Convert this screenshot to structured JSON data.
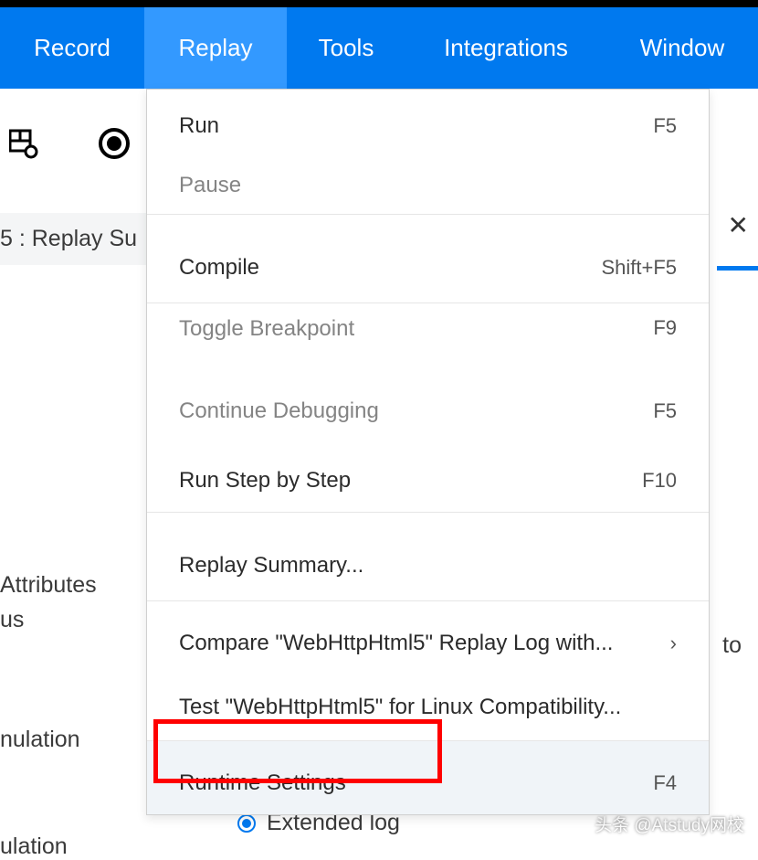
{
  "menubar": {
    "record": "Record",
    "replay": "Replay",
    "tools": "Tools",
    "integrations": "Integrations",
    "window": "Window"
  },
  "replay_menu": {
    "run": {
      "label": "Run",
      "shortcut": "F5"
    },
    "pause": {
      "label": "Pause"
    },
    "compile": {
      "label": "Compile",
      "shortcut": "Shift+F5"
    },
    "toggle_breakpoint": {
      "label": "Toggle Breakpoint",
      "shortcut": "F9"
    },
    "continue_debugging": {
      "label": "Continue Debugging",
      "shortcut": "F5"
    },
    "run_step": {
      "label": "Run Step by Step",
      "shortcut": "F10"
    },
    "replay_summary": {
      "label": "Replay Summary..."
    },
    "compare": {
      "label": "Compare \"WebHttpHtml5\" Replay Log with..."
    },
    "test_linux": {
      "label": "Test \"WebHttpHtml5\" for Linux Compatibility..."
    },
    "runtime_settings": {
      "label": "Runtime Settings",
      "shortcut": "F4"
    }
  },
  "background": {
    "summary_partial": "5 : Replay Su",
    "attributes_line1": "Attributes",
    "attributes_line2": "us",
    "nulation": "nulation",
    "ulation": "ulation",
    "to": "to",
    "extended_log": "Extended log"
  },
  "watermark": "头条 @Atstudy网校"
}
